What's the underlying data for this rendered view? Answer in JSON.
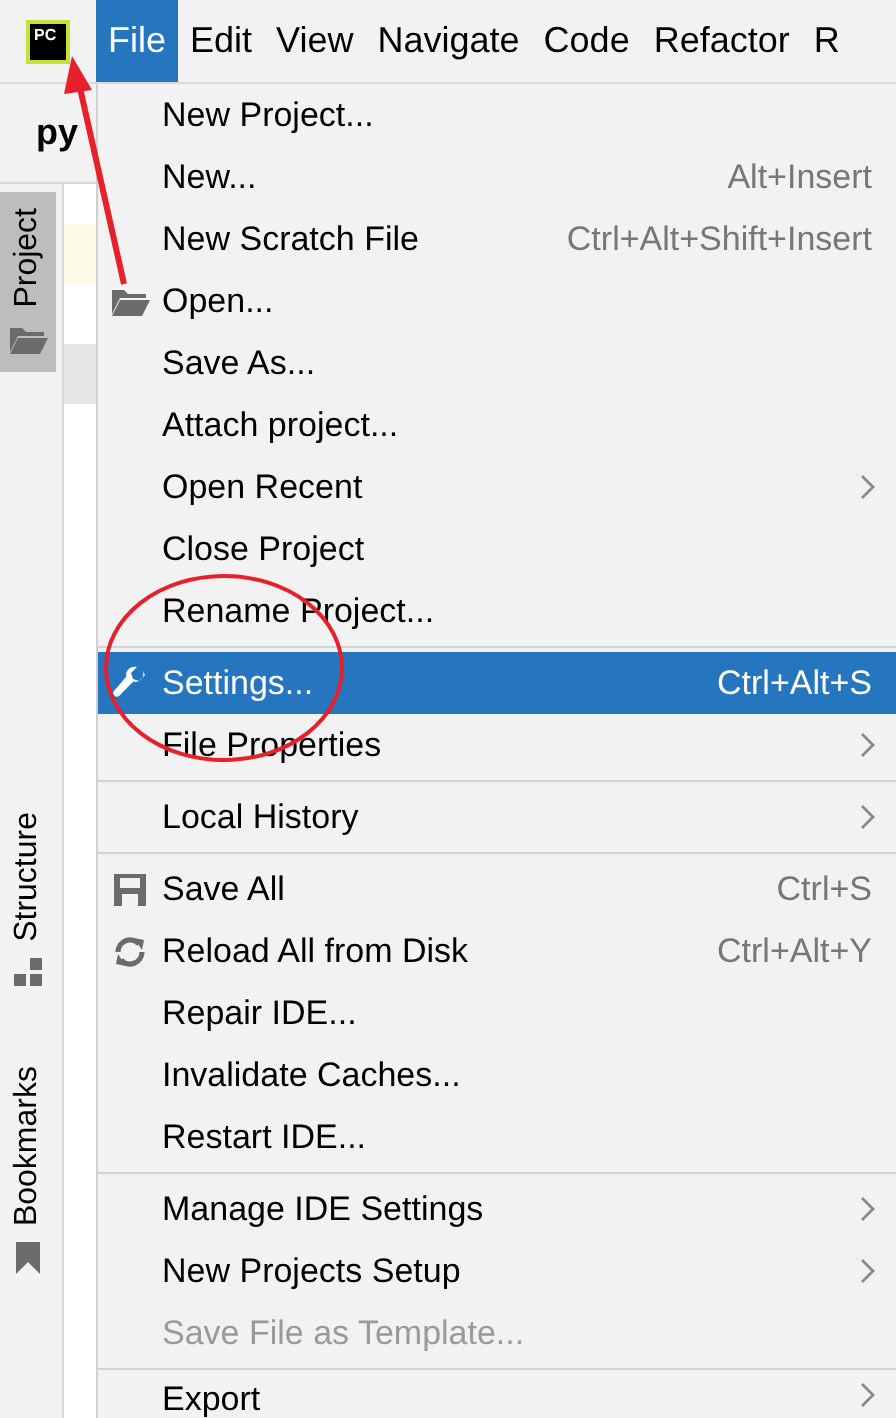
{
  "app_logo": "PC",
  "menubar": {
    "items": [
      {
        "label": "File",
        "selected": true
      },
      {
        "label": "Edit",
        "selected": false
      },
      {
        "label": "View",
        "selected": false
      },
      {
        "label": "Navigate",
        "selected": false
      },
      {
        "label": "Code",
        "selected": false
      },
      {
        "label": "Refactor",
        "selected": false
      },
      {
        "label": "R",
        "selected": false
      }
    ]
  },
  "project_title": "py",
  "side_tabs": [
    {
      "label": "Project",
      "selected": true
    },
    {
      "label": "Structure",
      "selected": false
    },
    {
      "label": "Bookmarks",
      "selected": false
    }
  ],
  "menu": {
    "items": [
      {
        "kind": "item",
        "label": "New Project...",
        "selected": false,
        "disabled": false
      },
      {
        "kind": "item",
        "label": "New...",
        "shortcut": "Alt+Insert",
        "selected": false,
        "disabled": false
      },
      {
        "kind": "item",
        "label": "New Scratch File",
        "shortcut": "Ctrl+Alt+Shift+Insert",
        "selected": false,
        "disabled": false
      },
      {
        "kind": "item",
        "label": "Open...",
        "selected": false,
        "disabled": false
      },
      {
        "kind": "item",
        "label": "Save As...",
        "selected": false,
        "disabled": false
      },
      {
        "kind": "item",
        "label": "Attach project...",
        "selected": false,
        "disabled": false
      },
      {
        "kind": "item",
        "label": "Open Recent",
        "submenu": true,
        "selected": false,
        "disabled": false
      },
      {
        "kind": "item",
        "label": "Close Project",
        "selected": false,
        "disabled": false
      },
      {
        "kind": "item",
        "label": "Rename Project...",
        "selected": false,
        "disabled": false
      },
      {
        "kind": "separator"
      },
      {
        "kind": "item",
        "label": "Settings...",
        "shortcut": "Ctrl+Alt+S",
        "selected": true,
        "disabled": false
      },
      {
        "kind": "item",
        "label": "File Properties",
        "submenu": true,
        "selected": false,
        "disabled": false
      },
      {
        "kind": "separator"
      },
      {
        "kind": "item",
        "label": "Local History",
        "submenu": true,
        "selected": false,
        "disabled": false
      },
      {
        "kind": "separator"
      },
      {
        "kind": "item",
        "label": "Save All",
        "shortcut": "Ctrl+S",
        "selected": false,
        "disabled": false
      },
      {
        "kind": "item",
        "label": "Reload All from Disk",
        "shortcut": "Ctrl+Alt+Y",
        "selected": false,
        "disabled": false
      },
      {
        "kind": "item",
        "label": "Repair IDE...",
        "selected": false,
        "disabled": false
      },
      {
        "kind": "item",
        "label": "Invalidate Caches...",
        "selected": false,
        "disabled": false
      },
      {
        "kind": "item",
        "label": "Restart IDE...",
        "selected": false,
        "disabled": false
      },
      {
        "kind": "separator"
      },
      {
        "kind": "item",
        "label": "Manage IDE Settings",
        "submenu": true,
        "selected": false,
        "disabled": false
      },
      {
        "kind": "item",
        "label": "New Projects Setup",
        "submenu": true,
        "selected": false,
        "disabled": false
      },
      {
        "kind": "item",
        "label": "Save File as Template...",
        "selected": false,
        "disabled": true
      },
      {
        "kind": "separator"
      },
      {
        "kind": "item",
        "label": "Export",
        "submenu": true,
        "selected": false,
        "disabled": false
      }
    ]
  },
  "annotations": [
    {
      "kind": "arrow",
      "color": "#e8202a"
    },
    {
      "kind": "circle",
      "color": "#e8202a"
    }
  ]
}
